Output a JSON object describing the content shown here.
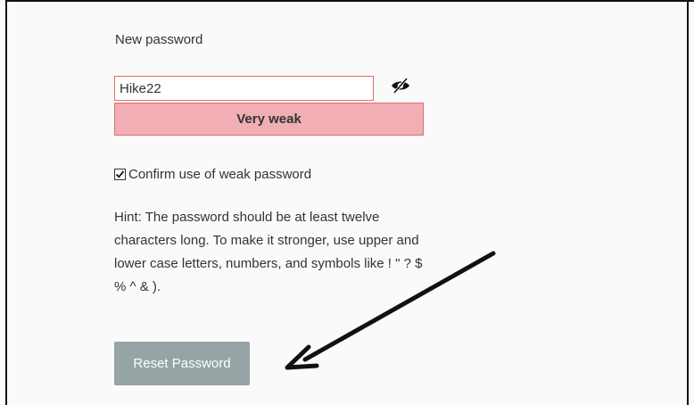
{
  "form": {
    "new_password_label": "New password",
    "password_value": "Hike22",
    "strength_text": "Very weak",
    "confirm_weak_label": "Confirm use of weak password",
    "confirm_weak_checked": true,
    "hint_text": "Hint: The password should be at least twelve characters long. To make it stronger, use upper and lower case letters, numbers, and symbols like ! \" ? $ % ^ & ).",
    "reset_button_label": "Reset Password"
  },
  "icons": {
    "toggle_visibility": "eye-slash-icon",
    "annotation": "arrow-icon"
  },
  "colors": {
    "strength_bg": "#f1aeb5",
    "strength_border": "#e07070",
    "button_bg": "#96a4a6"
  }
}
